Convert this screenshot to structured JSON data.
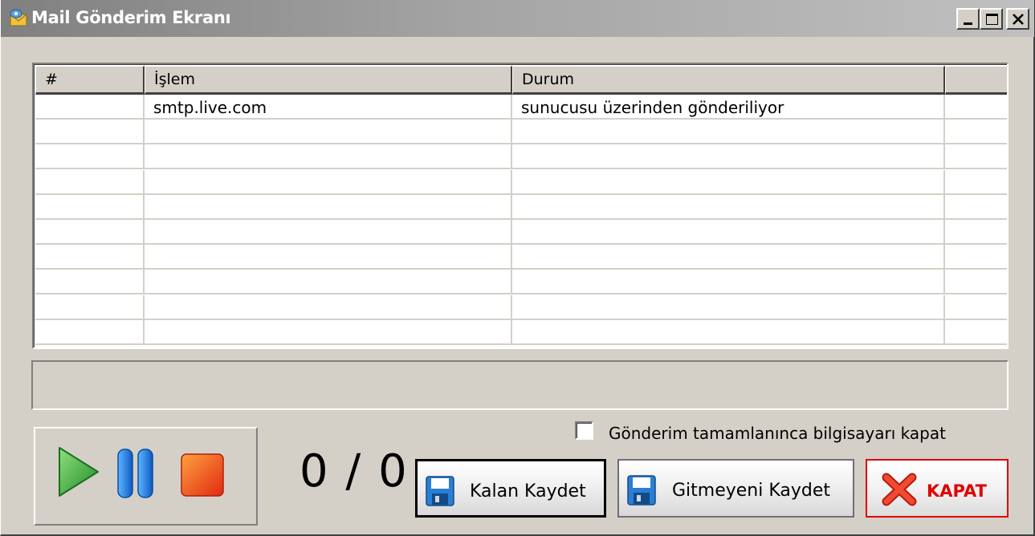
{
  "window": {
    "title": "Mail Gönderim Ekranı",
    "controls": {
      "minimize": "_",
      "maximize": "□",
      "close": "×"
    }
  },
  "grid": {
    "columns": [
      "#",
      "İşlem",
      "Durum",
      ""
    ],
    "rows": [
      [
        "",
        "smtp.live.com",
        "sunucusu üzerinden gönderiliyor",
        ""
      ],
      [
        "",
        "",
        "",
        ""
      ],
      [
        "",
        "",
        "",
        ""
      ],
      [
        "",
        "",
        "",
        ""
      ],
      [
        "",
        "",
        "",
        ""
      ],
      [
        "",
        "",
        "",
        ""
      ],
      [
        "",
        "",
        "",
        ""
      ],
      [
        "",
        "",
        "",
        ""
      ],
      [
        "",
        "",
        "",
        ""
      ],
      [
        "",
        "",
        "",
        ""
      ]
    ]
  },
  "status": {
    "text": ""
  },
  "controls": {
    "play_icon": "play-icon",
    "pause_icon": "pause-icon",
    "stop_icon": "stop-icon"
  },
  "counter": {
    "text": "0 / 0"
  },
  "shutdown_option": {
    "label": "Gönderim tamamlanınca bilgisayarı kapat",
    "checked": false
  },
  "buttons": {
    "save_remaining": "Kalan Kaydet",
    "save_unsent": "Gitmeyeni Kaydet",
    "close": "KAPAT"
  },
  "colors": {
    "accent_red": "#e00000",
    "play_green": "#3cb043",
    "pause_blue": "#1e7be0",
    "stop_orange": "#f25a1e"
  }
}
